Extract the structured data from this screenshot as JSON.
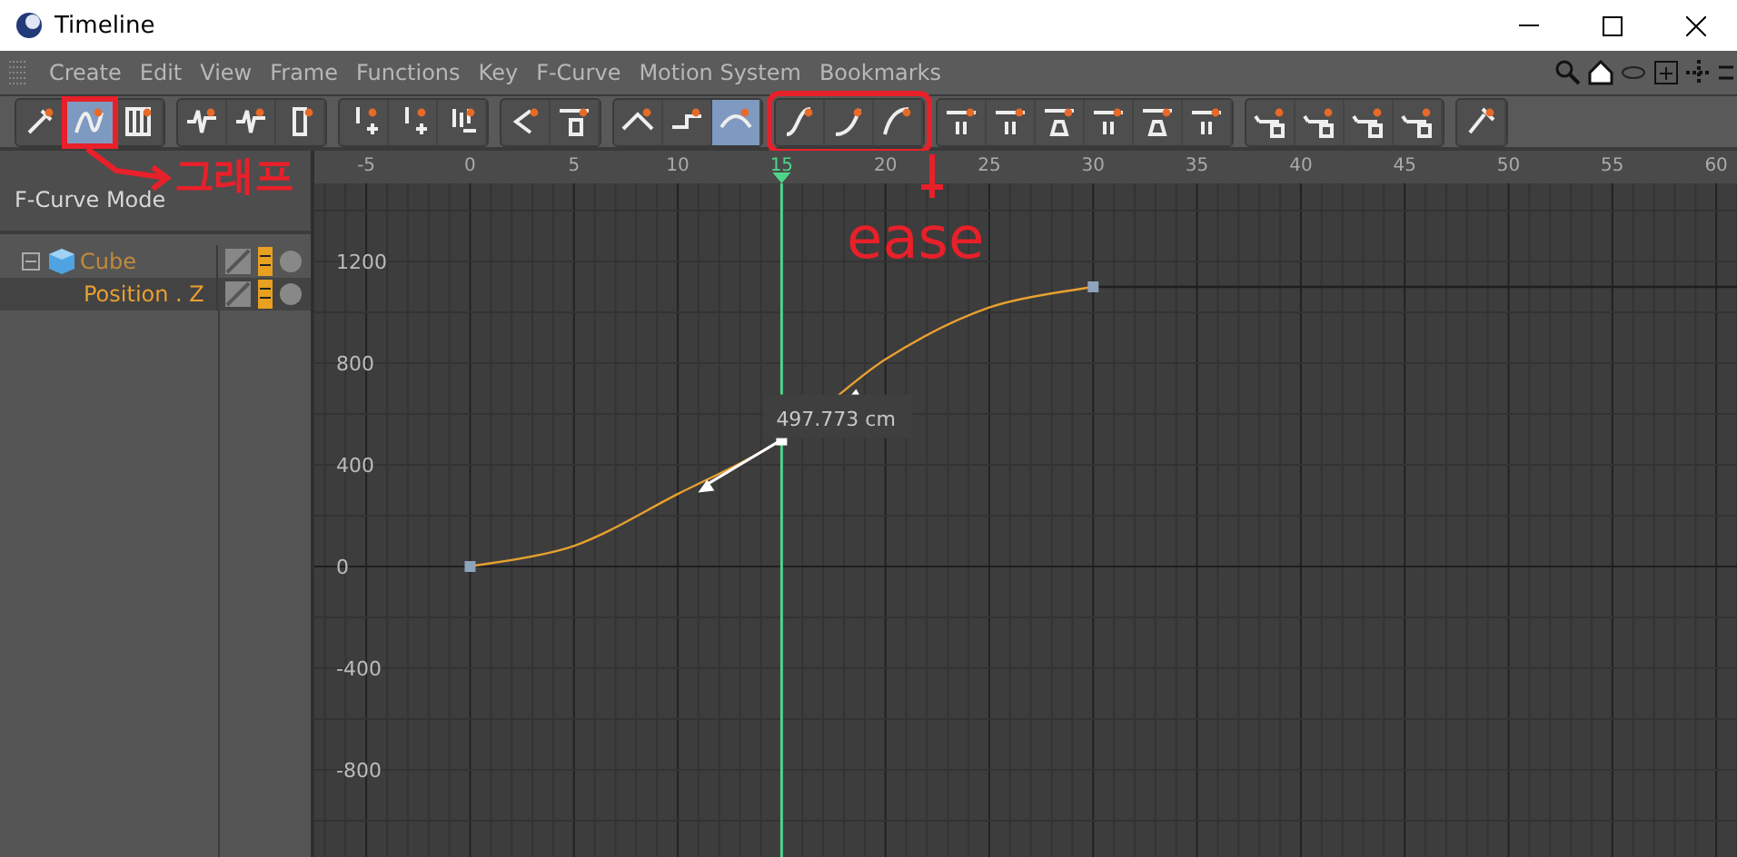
{
  "window": {
    "title": "Timeline"
  },
  "menu": [
    "Create",
    "Edit",
    "View",
    "Frame",
    "Functions",
    "Key",
    "F-Curve",
    "Motion System",
    "Bookmarks"
  ],
  "toolbar": {
    "groups": [
      {
        "marked": false,
        "buttons": [
          {
            "selected": false,
            "marked": false
          },
          {
            "selected": true,
            "marked": true
          },
          {
            "selected": false,
            "marked": false
          }
        ]
      },
      {
        "marked": false,
        "buttons": [
          {
            "selected": false,
            "marked": false
          },
          {
            "selected": false,
            "marked": false
          },
          {
            "selected": false,
            "marked": false
          }
        ]
      },
      {
        "marked": false,
        "buttons": [
          {
            "selected": false,
            "marked": false
          },
          {
            "selected": false,
            "marked": false
          },
          {
            "selected": false,
            "marked": false
          }
        ]
      },
      {
        "marked": false,
        "buttons": [
          {
            "selected": false,
            "marked": false
          },
          {
            "selected": false,
            "marked": false
          }
        ]
      },
      {
        "marked": false,
        "buttons": [
          {
            "selected": false,
            "marked": false
          },
          {
            "selected": false,
            "marked": false
          },
          {
            "selected": true,
            "marked": false
          }
        ]
      },
      {
        "marked": true,
        "buttons": [
          {
            "selected": false,
            "marked": false
          },
          {
            "selected": false,
            "marked": false
          },
          {
            "selected": false,
            "marked": false
          }
        ]
      },
      {
        "marked": false,
        "buttons": [
          {
            "selected": false,
            "marked": false
          },
          {
            "selected": false,
            "marked": false
          },
          {
            "selected": false,
            "marked": false
          },
          {
            "selected": false,
            "marked": false
          },
          {
            "selected": false,
            "marked": false
          },
          {
            "selected": false,
            "marked": false
          }
        ]
      },
      {
        "marked": false,
        "buttons": [
          {
            "selected": false,
            "marked": false
          },
          {
            "selected": false,
            "marked": false
          },
          {
            "selected": false,
            "marked": false
          },
          {
            "selected": false,
            "marked": false
          }
        ]
      },
      {
        "marked": false,
        "buttons": [
          {
            "selected": false,
            "marked": false
          }
        ]
      }
    ]
  },
  "mode_label": "F-Curve Mode",
  "tree": [
    {
      "label": "Cube",
      "expanded": true,
      "selected": false,
      "children": [
        {
          "label": "Position . Z",
          "selected": true
        }
      ]
    }
  ],
  "graph": {
    "chart_data": {
      "type": "line",
      "x": [
        0,
        5,
        10,
        15,
        20,
        25,
        30,
        61
      ],
      "series": [
        {
          "color": "#e8a030",
          "values": [
            0,
            81,
            285,
            498,
            815,
            1019,
            1100,
            null
          ]
        },
        {
          "color": "#1e1e1e",
          "values": [
            null,
            null,
            null,
            null,
            null,
            null,
            1100,
            1100
          ]
        }
      ],
      "xlim": [
        -7.5,
        61
      ],
      "ylim": [
        -1150,
        1507
      ],
      "xticks": [
        -5,
        0,
        5,
        10,
        15,
        20,
        25,
        30,
        35,
        40,
        45,
        50,
        55,
        60
      ],
      "yticks": [
        1200,
        800,
        400,
        0,
        -400,
        -800
      ],
      "grid": true,
      "ref_lines": [
        {
          "axis": "x",
          "value": 15,
          "color": "#4fd58a"
        }
      ],
      "annotations": [
        {
          "x": 15,
          "y": 497.773,
          "text": "497.773 cm"
        }
      ]
    }
  },
  "annotations": [
    {
      "text": "그래프"
    },
    {
      "text": "ease"
    }
  ]
}
